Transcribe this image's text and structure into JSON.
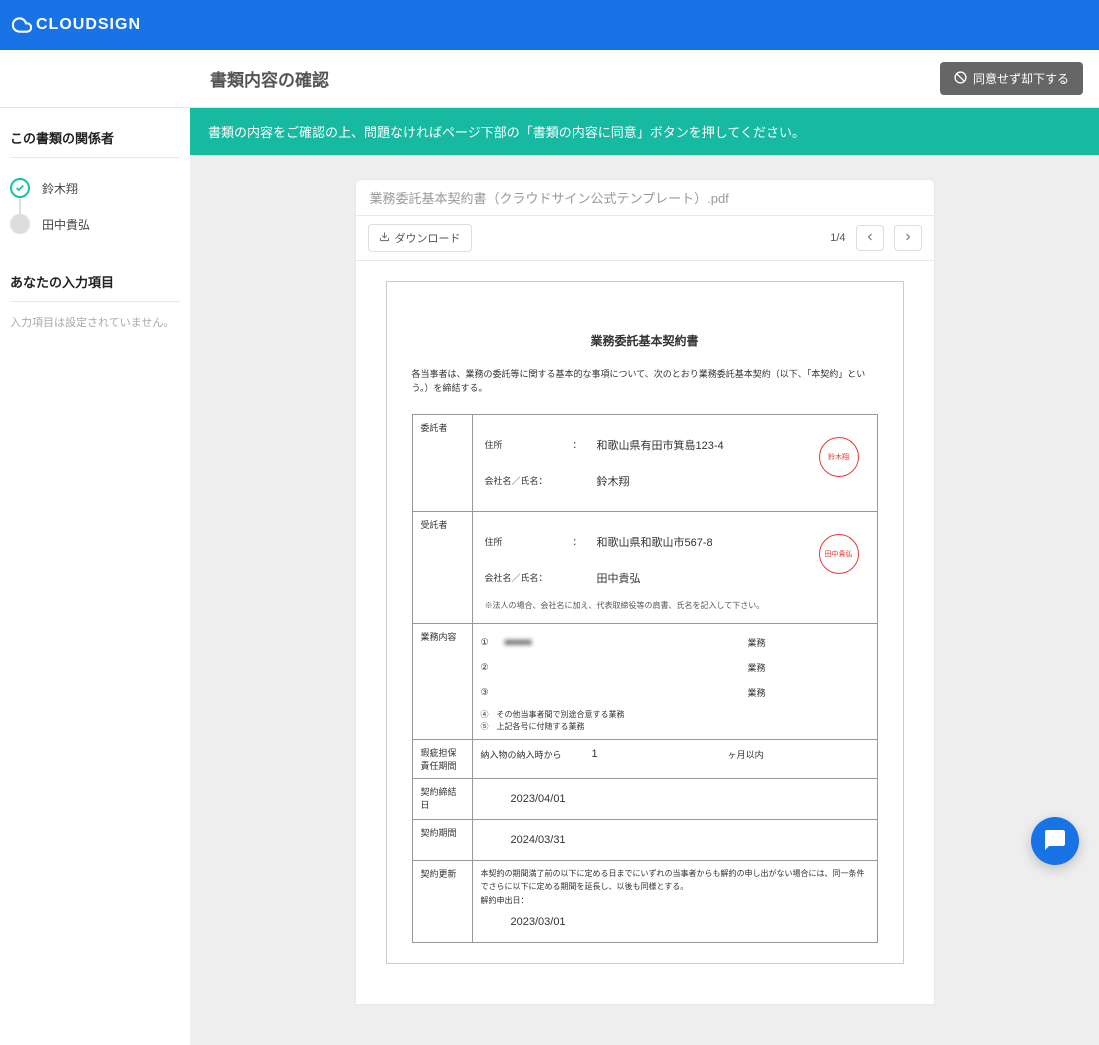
{
  "brand": "CLOUDSIGN",
  "subheader": {
    "title": "書類内容の確認",
    "reject_label": "同意せず却下する"
  },
  "sidebar": {
    "parties_title": "この書類の関係者",
    "parties": [
      {
        "name": "鈴木翔",
        "status": "done"
      },
      {
        "name": "田中貴弘",
        "status": "pending"
      }
    ],
    "inputs_title": "あなたの入力項目",
    "inputs_note": "入力項目は設定されていません。"
  },
  "banner": "書類の内容をご確認の上、問題なければページ下部の「書類の内容に同意」ボタンを押してください。",
  "document": {
    "filename": "業務委託基本契約書（クラウドサイン公式テンプレート）.pdf",
    "download_label": "ダウンロード",
    "page_indicator": "1/4",
    "title": "業務委託基本契約書",
    "intro": "各当事者は、業務の委託等に関する基本的な事項について、次のとおり業務委託基本契約（以下、「本契約」という。）を締結する。",
    "labels": {
      "itakusha": "委託者",
      "jutakusha": "受託者",
      "address": "住所",
      "company_name": "会社名／氏名：",
      "note_corp": "※法人の場合、会社名に加え、代表取締役等の肩書、氏名を記入して下さい。",
      "gyomu": "業務内容",
      "kashi": "瑕疵担保責任期間",
      "keiyaku_date": "契約締結日",
      "keiyaku_kikan": "契約期間",
      "keiyaku_koshin": "契約更新"
    },
    "party_a": {
      "address": "和歌山県有田市箕島123-4",
      "name": "鈴木翔",
      "stamp": "鈴木翔"
    },
    "party_b": {
      "address": "和歌山県和歌山市567-8",
      "name": "田中貴弘",
      "stamp": "田中貴弘"
    },
    "works": [
      {
        "num": "①",
        "name": "■■■■■",
        "type": "業務"
      },
      {
        "num": "②",
        "name": "",
        "type": "業務"
      },
      {
        "num": "③",
        "name": "",
        "type": "業務"
      }
    ],
    "work_note1": "④　その他当事者間で別途合意する業務",
    "work_note2": "⑤　上記各号に付随する業務",
    "kashi": {
      "prefix": "納入物の納入時から",
      "value": "1",
      "suffix": "ヶ月以内"
    },
    "contract_date": "2023/04/01",
    "contract_period": "2024/03/31",
    "renewal": {
      "text": "本契約の期間満了前の以下に定める日までにいずれの当事者からも解約の申し出がない場合には、同一条件でさらに以下に定める期間を延長し、以後も同様とする。",
      "apply_label": "解約申出日：",
      "apply_date": "2023/03/01"
    }
  }
}
